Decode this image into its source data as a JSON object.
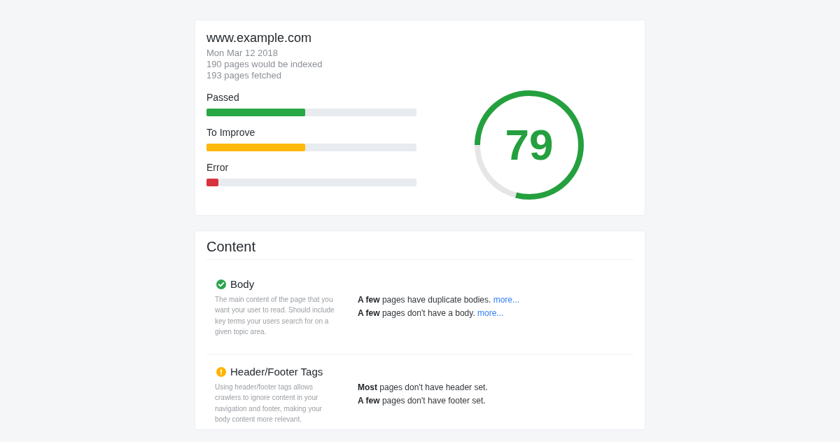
{
  "site": {
    "title": "www.example.com",
    "meta": [
      "Mon Mar 12 2018",
      "190 pages would be indexed",
      "193 pages fetched"
    ]
  },
  "bars": [
    {
      "label": "Passed",
      "level": 0.47,
      "color": "#28a745"
    },
    {
      "label": "To Improve",
      "level": 0.47,
      "color": "#ffb80c"
    },
    {
      "label": "Error",
      "level": 0.055,
      "color": "#d9323f"
    }
  ],
  "score": {
    "value": "79",
    "level": 0.79
  },
  "content": {
    "title": "Content",
    "sections": [
      {
        "title": "Body",
        "kind": "passed",
        "description": "The main content of the page that you want your user to read. Should include key terms your users search for on a given topic area.",
        "findings": [
          {
            "text": "**A few** pages have duplicate bodies.",
            "link": "more..."
          },
          {
            "text": "**A few** pages don't have a body.",
            "link": "more..."
          }
        ]
      },
      {
        "title": "Header/Footer Tags",
        "kind": "warning",
        "description": "Using header/footer tags allows crawlers to ignore content in your navigation and footer, making your body content more relevant.",
        "findings": [
          {
            "text": "**Most** pages don't have header set."
          },
          {
            "text": "**A few** pages don't have footer set."
          }
        ]
      }
    ]
  }
}
